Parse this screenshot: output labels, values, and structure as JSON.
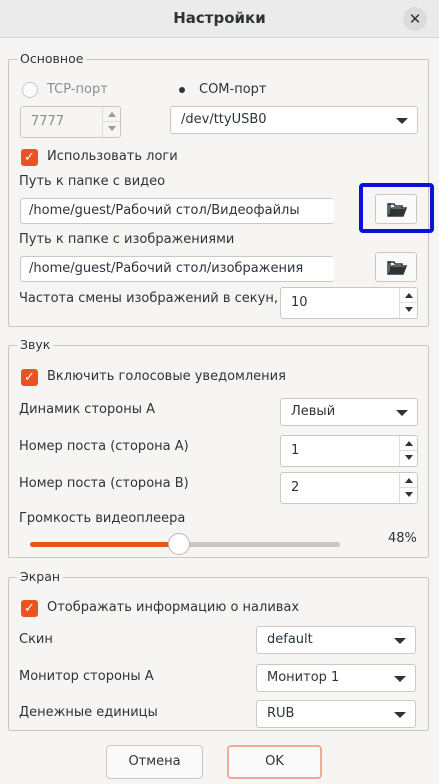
{
  "window": {
    "title": "Настройки",
    "close_glyph": "✕"
  },
  "basic": {
    "group_title": "Основное",
    "tcp_label": "TCP-порт",
    "com_label": "COM-порт",
    "tcp_port_value": "7777",
    "com_port_value": "/dev/ttyUSB0",
    "use_logs_label": "Использовать логи",
    "use_logs_checked": true,
    "video_path_label": "Путь к папке с видео",
    "video_path_value": "/home/guest/Рабочий стол/Видеофайлы",
    "images_path_label": "Путь к папке с изображениями",
    "images_path_value": "/home/guest/Рабочий стол/изображения",
    "image_rate_label": "Частота смены изображений в секун,",
    "image_rate_value": "10"
  },
  "sound": {
    "group_title": "Звук",
    "voice_notifications_label": "Включить голосовые уведомления",
    "voice_notifications_checked": true,
    "speaker_a_label": "Динамик стороны А",
    "speaker_a_value": "Левый",
    "post_a_label": "Номер поста (сторона А)",
    "post_a_value": "1",
    "post_b_label": "Номер поста (сторона В)",
    "post_b_value": "2",
    "volume_label": "Громкость видеоплеера",
    "volume_text": "48%",
    "volume_fraction": 0.48
  },
  "screen": {
    "group_title": "Экран",
    "show_info_label": "Отображать информацию о наливах",
    "show_info_checked": true,
    "skin_label": "Скин",
    "skin_value": "default",
    "monitor_a_label": "Монитор стороны А",
    "monitor_a_value": "Монитор 1",
    "currency_label": "Денежные единицы",
    "currency_value": "RUB"
  },
  "buttons": {
    "cancel": "Отмена",
    "ok": "OK"
  },
  "icons": {
    "folder": "folder-open-icon",
    "check": "✓"
  },
  "colors": {
    "accent": "#e95420",
    "highlight": "#0a14d8"
  }
}
